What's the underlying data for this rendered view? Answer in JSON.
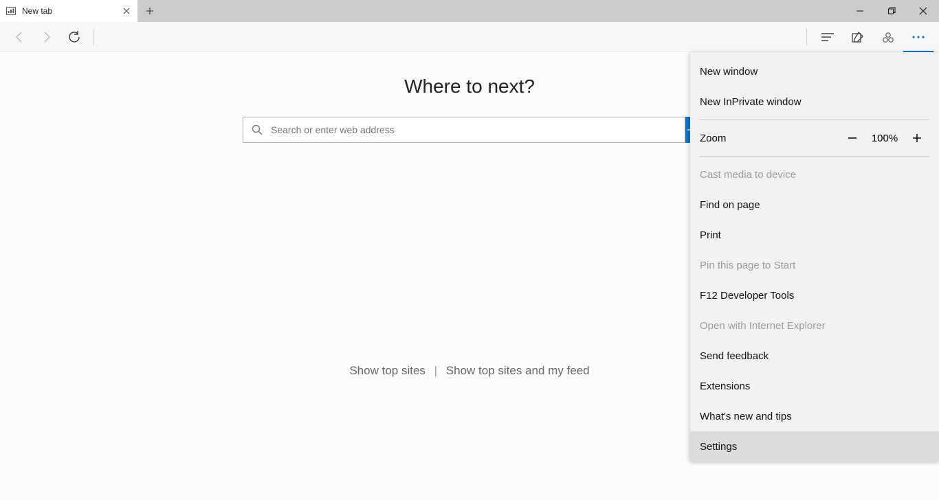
{
  "tab": {
    "title": "New tab"
  },
  "page": {
    "heading": "Where to next?",
    "search_placeholder": "Search or enter web address",
    "show_top_sites": "Show top sites",
    "show_feed": "Show top sites and my feed"
  },
  "menu": {
    "new_window": "New window",
    "new_inprivate": "New InPrivate window",
    "zoom_label": "Zoom",
    "zoom_value": "100%",
    "cast": "Cast media to device",
    "find": "Find on page",
    "print": "Print",
    "pin": "Pin this page to Start",
    "devtools": "F12 Developer Tools",
    "open_ie": "Open with Internet Explorer",
    "feedback": "Send feedback",
    "extensions": "Extensions",
    "whatsnew": "What's new and tips",
    "settings": "Settings"
  }
}
